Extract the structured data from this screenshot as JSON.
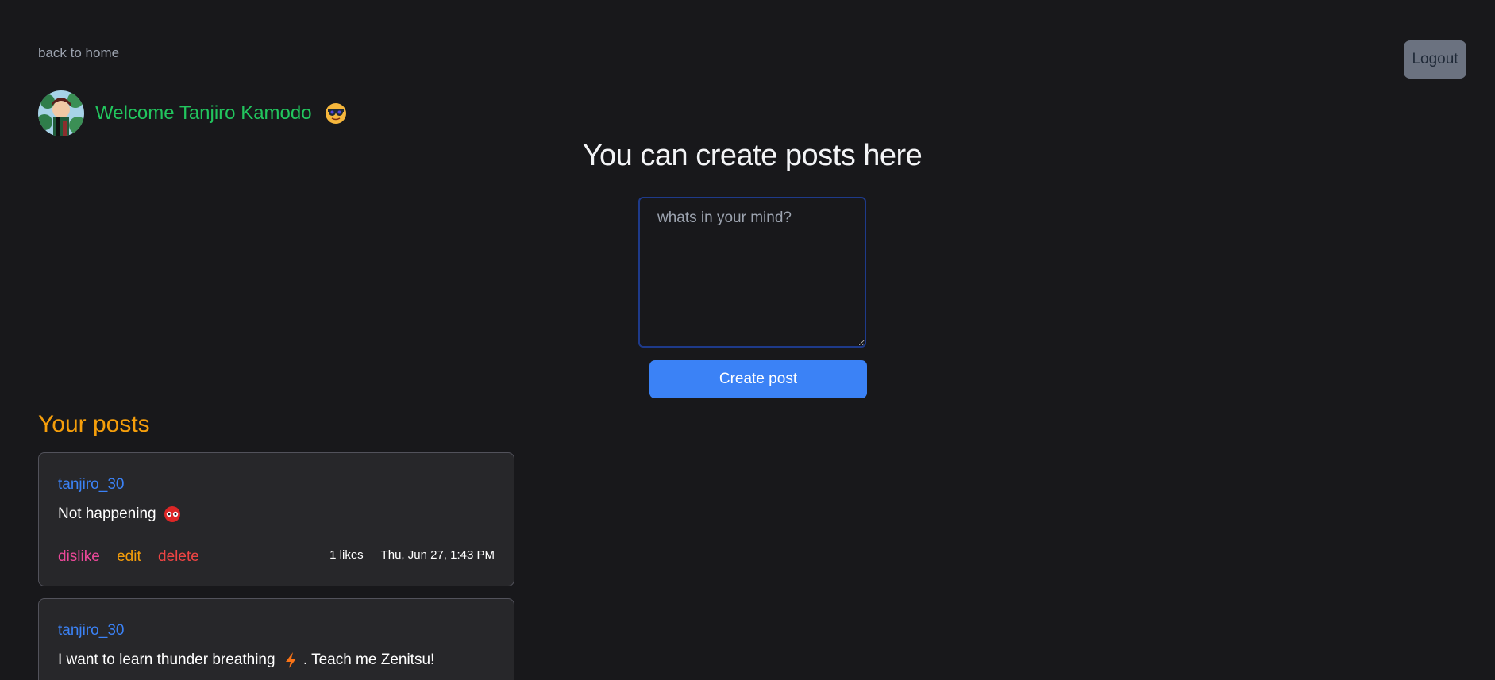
{
  "nav": {
    "back_label": "back to home",
    "logout_label": "Logout"
  },
  "welcome": {
    "text": "Welcome Tanjiro Kamodo",
    "emoji": "sunglasses-face-icon"
  },
  "composer": {
    "title": "You can create posts here",
    "placeholder": "whats in your mind?",
    "submit_label": "Create post"
  },
  "posts_section": {
    "heading": "Your posts",
    "posts": [
      {
        "username": "tanjiro_30",
        "content": "Not happening",
        "content_emoji": "no-entry-face-icon",
        "actions": {
          "dislike": "dislike",
          "edit": "edit",
          "delete": "delete"
        },
        "likes": "1 likes",
        "timestamp": "Thu, Jun 27, 1:43 PM"
      },
      {
        "username": "tanjiro_30",
        "content_before": "I want to learn thunder breathing",
        "content_emoji": "lightning-icon",
        "content_after": ". Teach me Zenitsu!"
      }
    ]
  },
  "colors": {
    "background": "#18181b",
    "card": "#27272a",
    "accent_blue": "#3b82f6",
    "welcome_green": "#22c55e",
    "heading_amber": "#f59e0b",
    "dislike_pink": "#ec4899",
    "delete_red": "#ef4444"
  }
}
